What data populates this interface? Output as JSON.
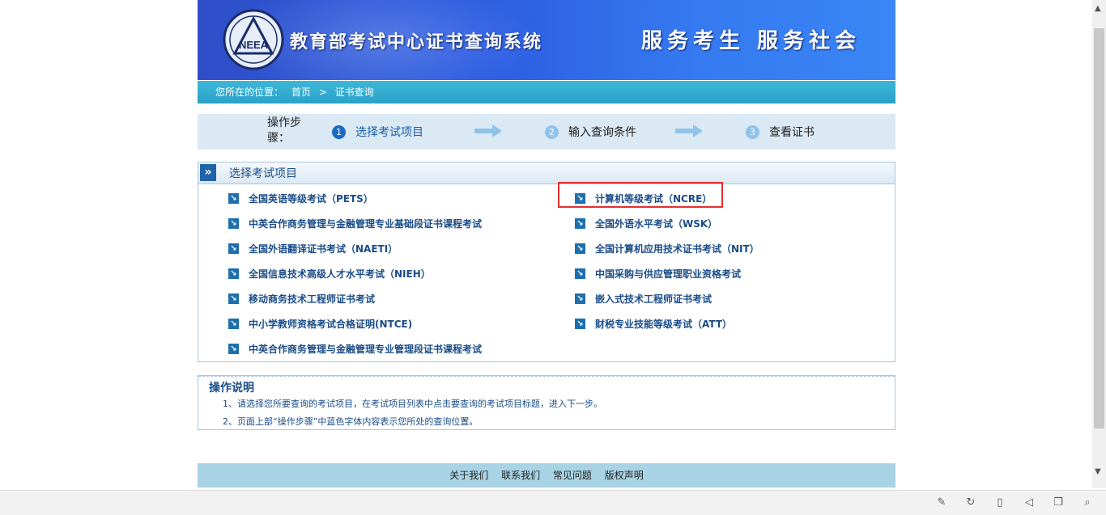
{
  "banner": {
    "title": "教育部考试中心证书查询系统",
    "slogan": "服务考生  服务社会",
    "logo_text": "NEEA"
  },
  "breadcrumb": {
    "prefix": "您所在的位置：",
    "home": "首页",
    "separator": ">",
    "current": "证书查询"
  },
  "steps": {
    "label": "操作步骤：",
    "items": [
      {
        "num": "1",
        "label": "选择考试项目",
        "active": true
      },
      {
        "num": "2",
        "label": "输入查询条件",
        "active": false
      },
      {
        "num": "3",
        "label": "查看证书",
        "active": false
      }
    ]
  },
  "exams": {
    "title": "选择考试项目",
    "left": [
      "全国英语等级考试（PETS）",
      "中英合作商务管理与金融管理专业基础段证书课程考试",
      "全国外语翻译证书考试（NAETI）",
      "全国信息技术高级人才水平考试（NIEH）",
      "移动商务技术工程师证书考试",
      "中小学教师资格考试合格证明(NTCE)",
      "中英合作商务管理与金融管理专业管理段证书课程考试"
    ],
    "right": [
      "计算机等级考试（NCRE）",
      "全国外语水平考试（WSK）",
      "全国计算机应用技术证书考试（NIT）",
      "中国采购与供应管理职业资格考试",
      "嵌入式技术工程师证书考试",
      "财税专业技能等级考试（ATT）"
    ],
    "highlighted": "计算机等级考试（NCRE）"
  },
  "notes": {
    "title": "操作说明",
    "lines": [
      "1、请选择您所要查询的考试项目，在考试项目列表中点击要查询的考试项目标题，进入下一步。",
      "2、页面上部“操作步骤”中蓝色字体内容表示您所处的查询位置。"
    ]
  },
  "footer": {
    "links": [
      "关于我们",
      "联系我们",
      "常见问题",
      "版权声明"
    ]
  },
  "colors": {
    "banner": "#2c5be0",
    "breadcrumb_bg": "#2aa2c9",
    "steps_bg": "#dbe9f5",
    "active_step": "#1a5ea8",
    "exam_text": "#1a4c88",
    "highlight_border": "#e03030",
    "footer_bg": "#a8d3e4"
  }
}
